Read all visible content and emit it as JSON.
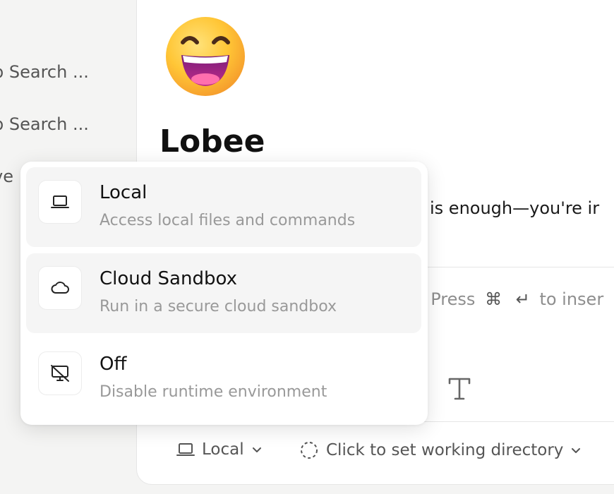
{
  "sidebar": {
    "items": [
      {
        "label": "b Search ..."
      },
      {
        "label": "b Search ..."
      },
      {
        "label": "ve"
      }
    ]
  },
  "agent": {
    "title": "Lobee",
    "description_visible": "is enough—you're ir",
    "emoji_icon": "grinning-face-with-smiling-eyes-icon"
  },
  "input": {
    "hint_left": ", Press",
    "hint_key1": "⌘",
    "hint_key2": "↵",
    "hint_right": "to inser"
  },
  "runtime_menu": {
    "options": [
      {
        "title": "Local",
        "description": "Access local files and commands",
        "icon": "laptop-icon"
      },
      {
        "title": "Cloud Sandbox",
        "description": "Run in a secure cloud sandbox",
        "icon": "cloud-icon"
      },
      {
        "title": "Off",
        "description": "Disable runtime environment",
        "icon": "monitor-off-icon"
      }
    ]
  },
  "bottom_bar": {
    "runtime_label": "Local",
    "workdir_label": "Click to set working directory"
  }
}
